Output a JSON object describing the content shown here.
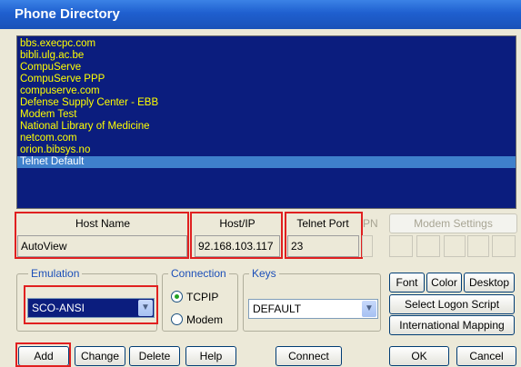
{
  "window": {
    "title": "Phone Directory"
  },
  "directory": {
    "entries": [
      "bbs.execpc.com",
      "bibli.ulg.ac.be",
      "CompuServe",
      "CompuServe PPP",
      "compuserve.com",
      "Defense Supply Center - EBB",
      "Modem Test",
      "National Library of Medicine",
      "netcom.com",
      "orion.bibsys.no",
      "Telnet Default"
    ],
    "selected_index": 10
  },
  "columns": {
    "host_name": "Host Name",
    "host_ip": "Host/IP",
    "telnet_port": "Telnet Port",
    "pn": "PN",
    "modem_settings": "Modem Settings"
  },
  "fields": {
    "host_name_value": "AutoView",
    "host_ip_value": "92.168.103.117",
    "telnet_port_value": "23"
  },
  "emulation": {
    "legend": "Emulation",
    "selected": "SCO-ANSI"
  },
  "connection": {
    "legend": "Connection",
    "tcpip": "TCPIP",
    "modem": "Modem",
    "selected": "TCPIP"
  },
  "keys": {
    "legend": "Keys",
    "selected": "DEFAULT"
  },
  "side_buttons": {
    "font": "Font",
    "color": "Color",
    "desktop": "Desktop",
    "logon_script": "Select Logon Script",
    "intl_mapping": "International Mapping"
  },
  "bottom_buttons": {
    "add": "Add",
    "change": "Change",
    "delete": "Delete",
    "help": "Help",
    "connect": "Connect",
    "ok": "OK",
    "cancel": "Cancel"
  },
  "colors": {
    "list_bg": "#0b1d7e",
    "list_text": "#ffff00",
    "selection": "#3f80cc",
    "highlight_box": "#e02020",
    "title_bar": "#1f5fcf"
  }
}
